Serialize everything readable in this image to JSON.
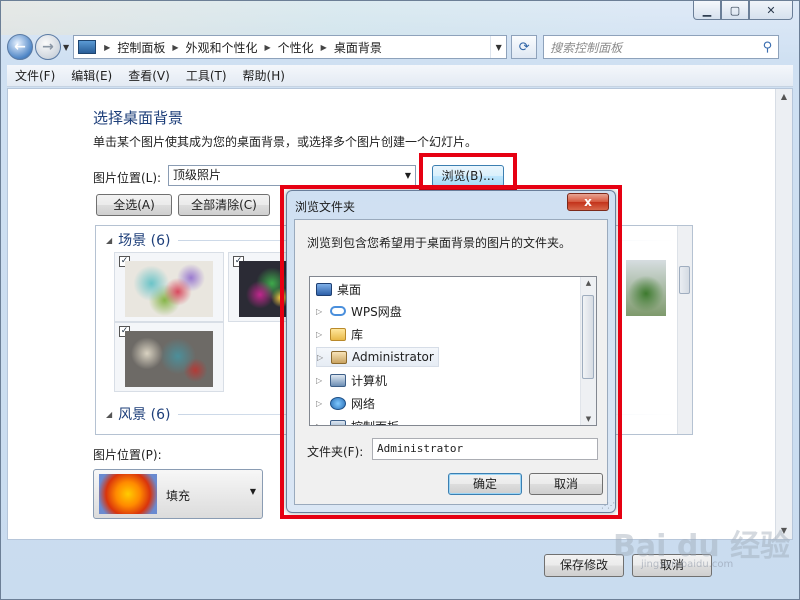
{
  "nav": {
    "breadcrumbs": [
      "控制面板",
      "外观和个性化",
      "个性化",
      "桌面背景"
    ],
    "search_placeholder": "搜索控制面板"
  },
  "menu": [
    "文件(F)",
    "编辑(E)",
    "查看(V)",
    "工具(T)",
    "帮助(H)"
  ],
  "page": {
    "title": "选择桌面背景",
    "description": "单击某个图片使其成为您的桌面背景，或选择多个图片创建一个幻灯片。",
    "location_label": "图片位置(L):",
    "location_value": "顶级照片",
    "browse_label": "浏览(B)...",
    "select_all_label": "全选(A)",
    "clear_all_label": "全部清除(C)",
    "groups": [
      {
        "name": "场景 (6)"
      },
      {
        "name": "风景 (6)"
      }
    ],
    "position_label": "图片位置(P):",
    "position_value": "填充",
    "save_label": "保存修改",
    "cancel_label": "取消"
  },
  "dialog": {
    "title": "浏览文件夹",
    "close_glyph": "x",
    "description": "浏览到包含您希望用于桌面背景的图片的文件夹。",
    "tree": [
      {
        "label": "桌面",
        "icon": "desktop-icon",
        "level": 0,
        "expandable": false,
        "selected": false
      },
      {
        "label": "WPS网盘",
        "icon": "cloud-icon",
        "level": 1,
        "expandable": true,
        "selected": false
      },
      {
        "label": "库",
        "icon": "library-folder-icon",
        "level": 1,
        "expandable": true,
        "selected": false
      },
      {
        "label": "Administrator",
        "icon": "user-folder-icon",
        "level": 1,
        "expandable": true,
        "selected": true
      },
      {
        "label": "计算机",
        "icon": "computer-icon",
        "level": 1,
        "expandable": true,
        "selected": false
      },
      {
        "label": "网络",
        "icon": "network-icon",
        "level": 1,
        "expandable": true,
        "selected": false
      },
      {
        "label": "控制面板",
        "icon": "control-panel-icon",
        "level": 1,
        "expandable": true,
        "selected": false
      }
    ],
    "folder_label": "文件夹(F):",
    "folder_value": "Administrator",
    "ok_label": "确定",
    "cancel_label": "取消"
  },
  "watermark": {
    "text": "Bai du 经验",
    "sub": "jingyan.baidu.com"
  }
}
